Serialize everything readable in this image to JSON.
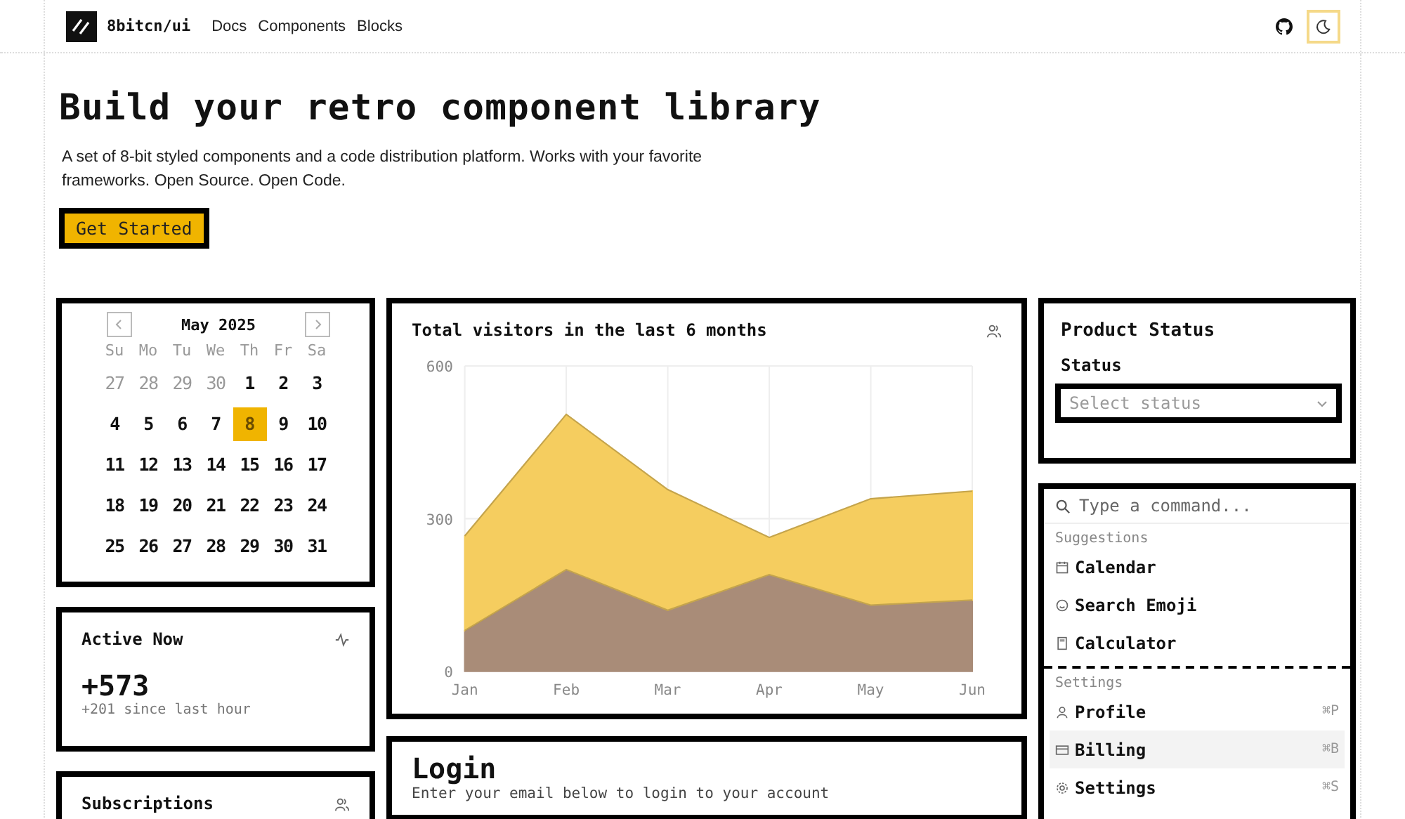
{
  "header": {
    "brand": "8bitcn/ui",
    "nav": [
      "Docs",
      "Components",
      "Blocks"
    ]
  },
  "hero": {
    "title": "Build your retro component library",
    "description": "A set of 8-bit styled components and a code distribution platform. Works with your favorite frameworks. Open Source. Open Code.",
    "button": "Get Started"
  },
  "calendar": {
    "month": "May 2025",
    "weekdays": [
      "Su",
      "Mo",
      "Tu",
      "We",
      "Th",
      "Fr",
      "Sa"
    ],
    "days": [
      {
        "label": "27",
        "outside": true,
        "selected": false
      },
      {
        "label": "28",
        "outside": true,
        "selected": false
      },
      {
        "label": "29",
        "outside": true,
        "selected": false
      },
      {
        "label": "30",
        "outside": true,
        "selected": false
      },
      {
        "label": "1",
        "outside": false,
        "selected": false
      },
      {
        "label": "2",
        "outside": false,
        "selected": false
      },
      {
        "label": "3",
        "outside": false,
        "selected": false
      },
      {
        "label": "4",
        "outside": false,
        "selected": false
      },
      {
        "label": "5",
        "outside": false,
        "selected": false
      },
      {
        "label": "6",
        "outside": false,
        "selected": false
      },
      {
        "label": "7",
        "outside": false,
        "selected": false
      },
      {
        "label": "8",
        "outside": false,
        "selected": true
      },
      {
        "label": "9",
        "outside": false,
        "selected": false
      },
      {
        "label": "10",
        "outside": false,
        "selected": false
      },
      {
        "label": "11",
        "outside": false,
        "selected": false
      },
      {
        "label": "12",
        "outside": false,
        "selected": false
      },
      {
        "label": "13",
        "outside": false,
        "selected": false
      },
      {
        "label": "14",
        "outside": false,
        "selected": false
      },
      {
        "label": "15",
        "outside": false,
        "selected": false
      },
      {
        "label": "16",
        "outside": false,
        "selected": false
      },
      {
        "label": "17",
        "outside": false,
        "selected": false
      },
      {
        "label": "18",
        "outside": false,
        "selected": false
      },
      {
        "label": "19",
        "outside": false,
        "selected": false
      },
      {
        "label": "20",
        "outside": false,
        "selected": false
      },
      {
        "label": "21",
        "outside": false,
        "selected": false
      },
      {
        "label": "22",
        "outside": false,
        "selected": false
      },
      {
        "label": "23",
        "outside": false,
        "selected": false
      },
      {
        "label": "24",
        "outside": false,
        "selected": false
      },
      {
        "label": "25",
        "outside": false,
        "selected": false
      },
      {
        "label": "26",
        "outside": false,
        "selected": false
      },
      {
        "label": "27",
        "outside": false,
        "selected": false
      },
      {
        "label": "28",
        "outside": false,
        "selected": false
      },
      {
        "label": "29",
        "outside": false,
        "selected": false
      },
      {
        "label": "30",
        "outside": false,
        "selected": false
      },
      {
        "label": "31",
        "outside": false,
        "selected": false
      }
    ]
  },
  "active_now": {
    "title": "Active Now",
    "value": "+573",
    "note": "+201 since last hour"
  },
  "subscriptions": {
    "title": "Subscriptions"
  },
  "visitors": {
    "title": "Total visitors in the last 6 months",
    "chart_data": {
      "type": "area",
      "stacked": true,
      "categories": [
        "Jan",
        "Feb",
        "Mar",
        "Apr",
        "May",
        "Jun"
      ],
      "ylim": [
        0,
        600
      ],
      "yticks": [
        0,
        300,
        600
      ],
      "grid": true,
      "series": [
        {
          "color": "#a98c78",
          "values": [
            80,
            200,
            120,
            190,
            130,
            140
          ]
        },
        {
          "color": "#f5cd5f",
          "values": [
            186,
            305,
            237,
            73,
            209,
            214
          ]
        }
      ]
    }
  },
  "login": {
    "title": "Login",
    "subtitle": "Enter your email below to login to your account"
  },
  "product_status": {
    "title": "Product Status",
    "label": "Status",
    "placeholder": "Select status"
  },
  "command": {
    "placeholder": "Type a command...",
    "groups": [
      {
        "heading": "Suggestions",
        "items": [
          {
            "label": "Calendar",
            "selected": false
          },
          {
            "label": "Search Emoji",
            "selected": false
          },
          {
            "label": "Calculator",
            "selected": false
          }
        ]
      },
      {
        "heading": "Settings",
        "items": [
          {
            "label": "Profile",
            "shortcut": "⌘P",
            "selected": false
          },
          {
            "label": "Billing",
            "shortcut": "⌘B",
            "selected": true
          },
          {
            "label": "Settings",
            "shortcut": "⌘S",
            "selected": false
          }
        ]
      }
    ]
  }
}
